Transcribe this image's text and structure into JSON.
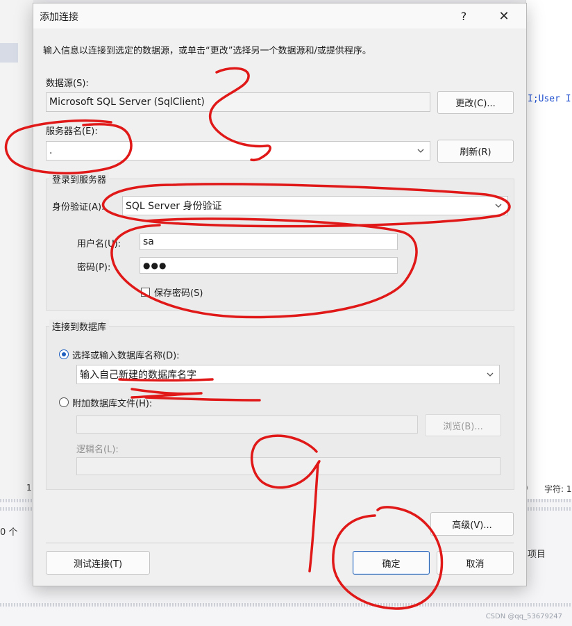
{
  "background": {
    "code_snippet": "I;User I",
    "status_left": "0 个",
    "status_left_num": "1",
    "status_right_paren": ")",
    "status_right": "字符: 1",
    "items_right": "项目",
    "watermark": "CSDN @qq_53679247"
  },
  "dialog": {
    "title": "添加连接",
    "help_glyph": "?",
    "close_glyph": "✕",
    "instruction": "输入信息以连接到选定的数据源，或单击“更改”选择另一个数据源和/或提供程序。",
    "datasource": {
      "label": "数据源(S):",
      "value": "Microsoft SQL Server (SqlClient)",
      "change_button": "更改(C)..."
    },
    "server": {
      "label": "服务器名(E):",
      "value": ".",
      "refresh_button": "刷新(R)"
    },
    "login_group": {
      "title": "登录到服务器",
      "auth_label": "身份验证(A):",
      "auth_value": "SQL Server 身份验证",
      "username_label": "用户名(U):",
      "username_value": "sa",
      "password_label": "密码(P):",
      "password_value": "●●●",
      "save_password_label": "保存密码(S)",
      "save_password_checked": false
    },
    "database_group": {
      "title": "连接到数据库",
      "select_db_label": "选择或输入数据库名称(D):",
      "select_db_value": "输入自己新建的数据库名字",
      "attach_label": "附加数据库文件(H):",
      "attach_value": "",
      "browse_button": "浏览(B)...",
      "logical_name_label": "逻辑名(L):",
      "logical_name_value": ""
    },
    "advanced_button": "高级(V)...",
    "test_button": "测试连接(T)",
    "ok_button": "确定",
    "cancel_button": "取消"
  },
  "colors": {
    "accent": "#1f5fbf",
    "annotation_red": "#e01818"
  }
}
